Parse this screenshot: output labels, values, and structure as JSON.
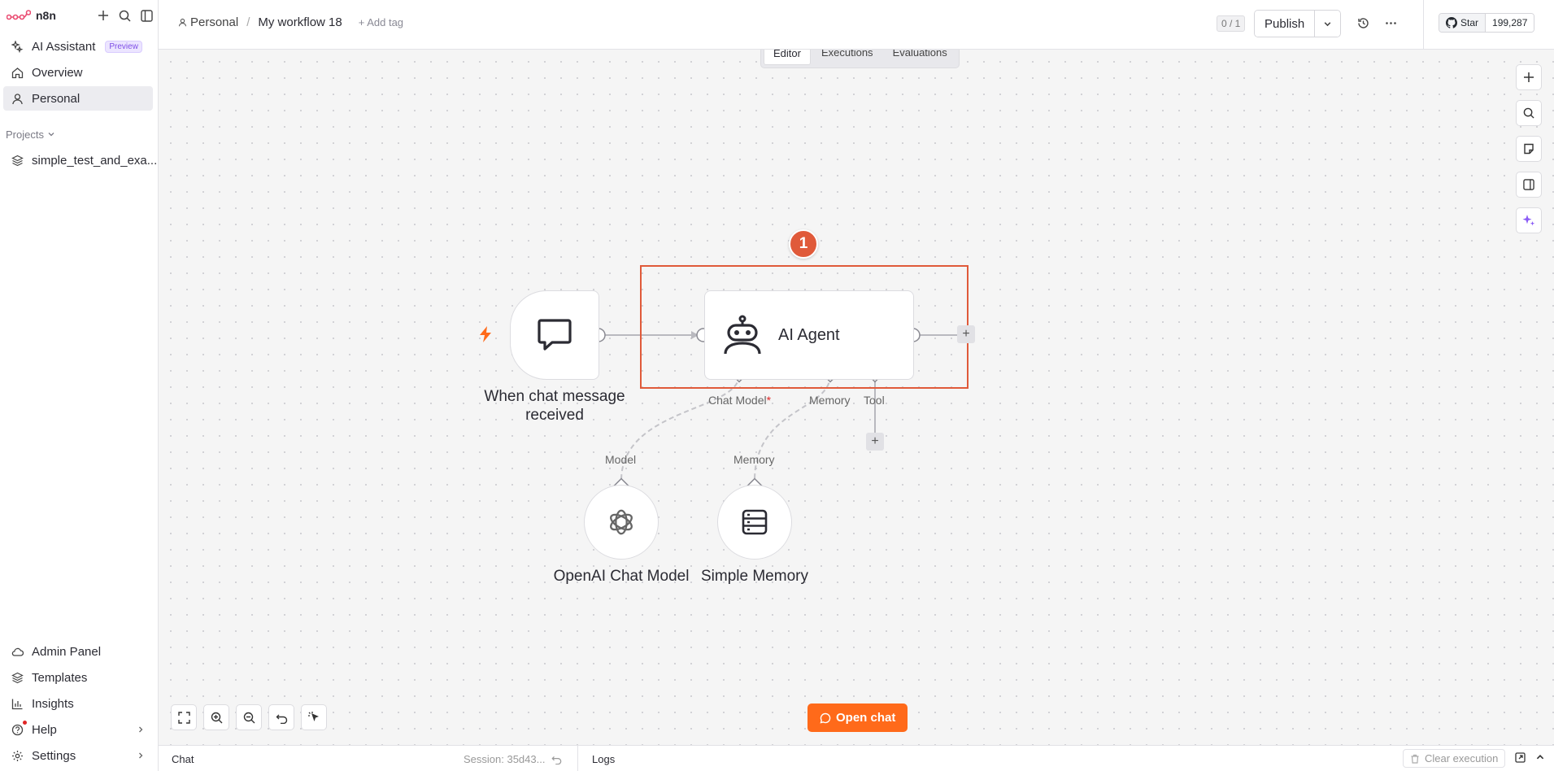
{
  "app": {
    "logo_text": "n8n"
  },
  "sidebar": {
    "items": [
      {
        "label": "AI Assistant",
        "badge": "Preview"
      },
      {
        "label": "Overview"
      },
      {
        "label": "Personal"
      }
    ],
    "projects_heading": "Projects",
    "projects": [
      {
        "label": "simple_test_and_exa..."
      }
    ],
    "bottom_items": [
      {
        "label": "Admin Panel"
      },
      {
        "label": "Templates"
      },
      {
        "label": "Insights"
      },
      {
        "label": "Help"
      },
      {
        "label": "Settings"
      }
    ]
  },
  "header": {
    "breadcrumb_project": "Personal",
    "breadcrumb_sep": "/",
    "workflow_title": "My workflow 18",
    "add_tag": "+ Add tag",
    "counter": "0 / 1",
    "publish_label": "Publish",
    "github_star_label": "Star",
    "github_star_count": "199,287"
  },
  "tabs": [
    {
      "label": "Editor",
      "active": true
    },
    {
      "label": "Executions"
    },
    {
      "label": "Evaluations"
    }
  ],
  "nodes": {
    "trigger_label_line1": "When chat message",
    "trigger_label_line2": "received",
    "agent_title": "AI Agent",
    "badge_number": "1",
    "port_chat_model": "Chat Model",
    "port_required_mark": "*",
    "port_memory": "Memory",
    "port_tool": "Tool",
    "model_input_label": "Model",
    "memory_input_label": "Memory",
    "openai_label": "OpenAI Chat Model",
    "memory_node_label": "Simple Memory",
    "plus": "+"
  },
  "canvas": {
    "open_chat_label": "Open chat"
  },
  "bottombar": {
    "chat_label": "Chat",
    "session_label": "Session: 35d43...",
    "logs_label": "Logs",
    "clear_label": "Clear execution"
  },
  "colors": {
    "accent_orange": "#ff6a1a",
    "selection_red": "#e05a3a",
    "preview_purple": "#7e4ee6",
    "trigger_bolt": "#ff6a1a",
    "ai_sparkle": "#8b5cf6"
  }
}
